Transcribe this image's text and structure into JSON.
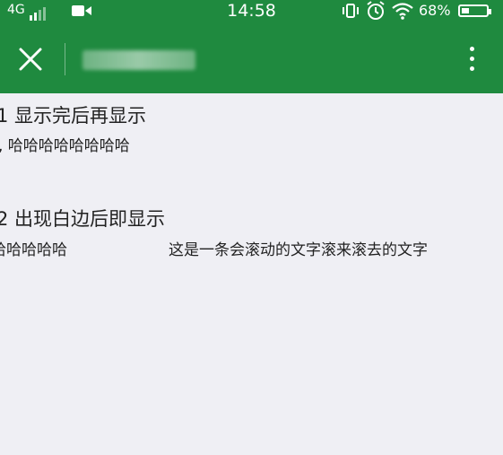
{
  "status_bar": {
    "network": "4G",
    "time": "14:58",
    "battery": "68%"
  },
  "nav": {
    "close_icon": "close-icon",
    "more_icon": "more-vertical-icon"
  },
  "content": {
    "section1": {
      "title": "1 显示完后再显示",
      "marquee_text": ", 哈哈哈哈哈哈哈哈"
    },
    "section2": {
      "title": "2 出现白边后即显示",
      "marquee_left": "哈哈哈哈哈",
      "marquee_right": "这是一条会滚动的文字滚来滚去的文字"
    }
  },
  "colors": {
    "header_green": "#1f8a3f",
    "page_bg": "#efeff4",
    "text": "#222222"
  }
}
